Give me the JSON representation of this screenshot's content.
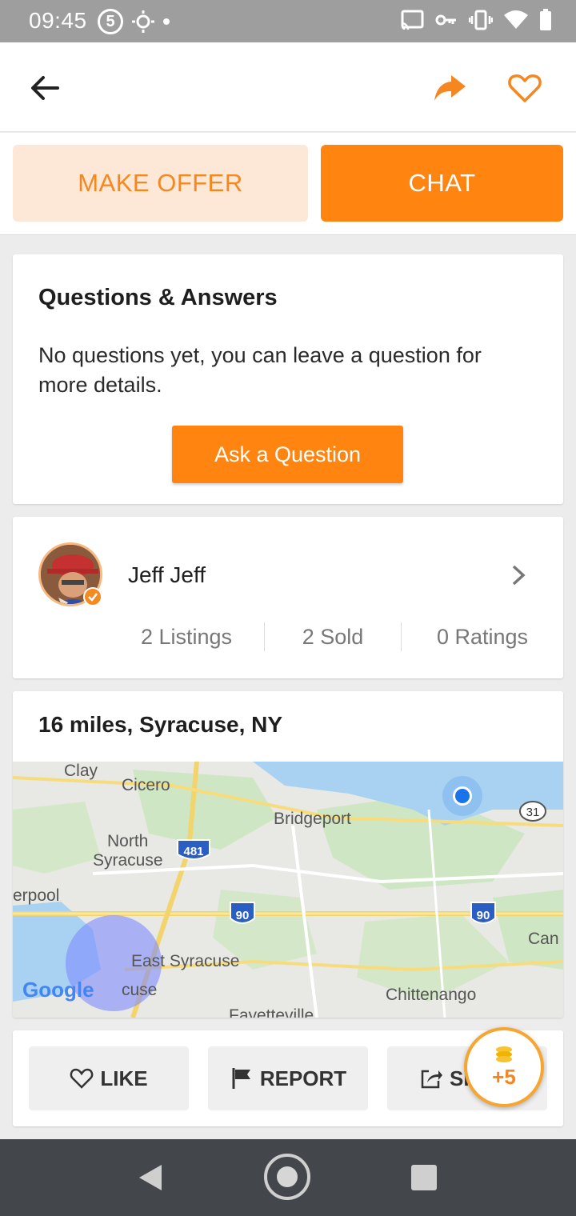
{
  "status_bar": {
    "time": "09:45",
    "notification_badge": "5"
  },
  "header": {
    "icons": [
      "back-arrow-icon",
      "share-icon",
      "heart-outline-icon"
    ]
  },
  "actions": {
    "make_offer": "MAKE OFFER",
    "chat": "CHAT"
  },
  "qa": {
    "title": "Questions & Answers",
    "empty_text": "No questions yet, you can leave a question for more details.",
    "ask_button": "Ask a Question"
  },
  "seller": {
    "name": "Jeff Jeff",
    "listings": "2 Listings",
    "sold": "2 Sold",
    "ratings": "0 Ratings"
  },
  "location": {
    "title": "16 miles, Syracuse, NY",
    "map_labels": {
      "clay": "Clay",
      "cicero": "Cicero",
      "bridgeport": "Bridgeport",
      "north_syracuse_1": "North",
      "north_syracuse_2": "Syracuse",
      "liverpool": "erpool",
      "east_syracuse": "East Syracuse",
      "syracuse": "cuse",
      "chittenango": "Chittenango",
      "canastota": "Can",
      "fayetteville": "Fayetteville",
      "google": "Google",
      "hwy_481": "481",
      "hwy_90a": "90",
      "hwy_90b": "90",
      "hwy_31": "31"
    }
  },
  "bottom_bar": {
    "like": "LIKE",
    "report": "REPORT",
    "share": "SHARE"
  },
  "coin_badge": {
    "text": "+5"
  },
  "colors": {
    "accent": "#ff8510",
    "accent_light": "#fde7d6",
    "status_bar": "#9e9e9e",
    "nav_bar": "#43474c"
  }
}
